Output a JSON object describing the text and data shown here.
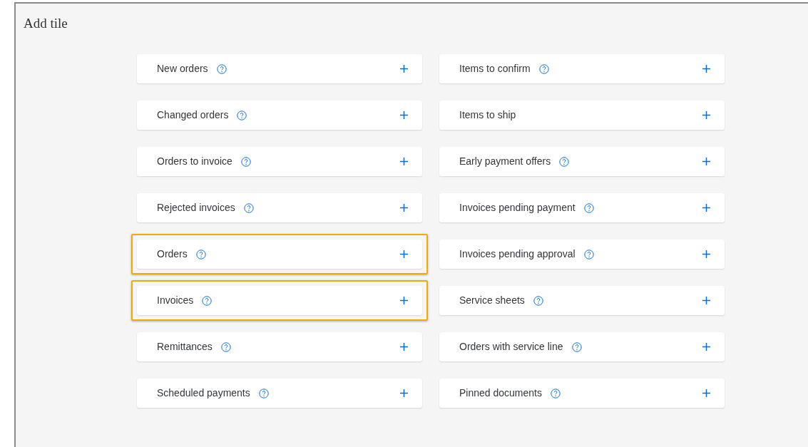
{
  "title": "Add tile",
  "columns": [
    [
      {
        "label": "New orders",
        "help": true,
        "highlighted": false
      },
      {
        "label": "Changed orders",
        "help": true,
        "highlighted": false
      },
      {
        "label": "Orders to invoice",
        "help": true,
        "highlighted": false
      },
      {
        "label": "Rejected invoices",
        "help": true,
        "highlighted": false
      },
      {
        "label": "Orders",
        "help": true,
        "highlighted": true
      },
      {
        "label": "Invoices",
        "help": true,
        "highlighted": true
      },
      {
        "label": "Remittances",
        "help": true,
        "highlighted": false
      },
      {
        "label": "Scheduled payments",
        "help": true,
        "highlighted": false
      }
    ],
    [
      {
        "label": "Items to confirm",
        "help": true,
        "highlighted": false
      },
      {
        "label": "Items to ship",
        "help": false,
        "highlighted": false
      },
      {
        "label": "Early payment offers",
        "help": true,
        "highlighted": false
      },
      {
        "label": "Invoices pending payment",
        "help": true,
        "highlighted": false
      },
      {
        "label": "Invoices pending approval",
        "help": true,
        "highlighted": false
      },
      {
        "label": "Service sheets",
        "help": true,
        "highlighted": false
      },
      {
        "label": "Orders with service line",
        "help": true,
        "highlighted": false
      },
      {
        "label": "Pinned documents",
        "help": true,
        "highlighted": false
      }
    ]
  ]
}
